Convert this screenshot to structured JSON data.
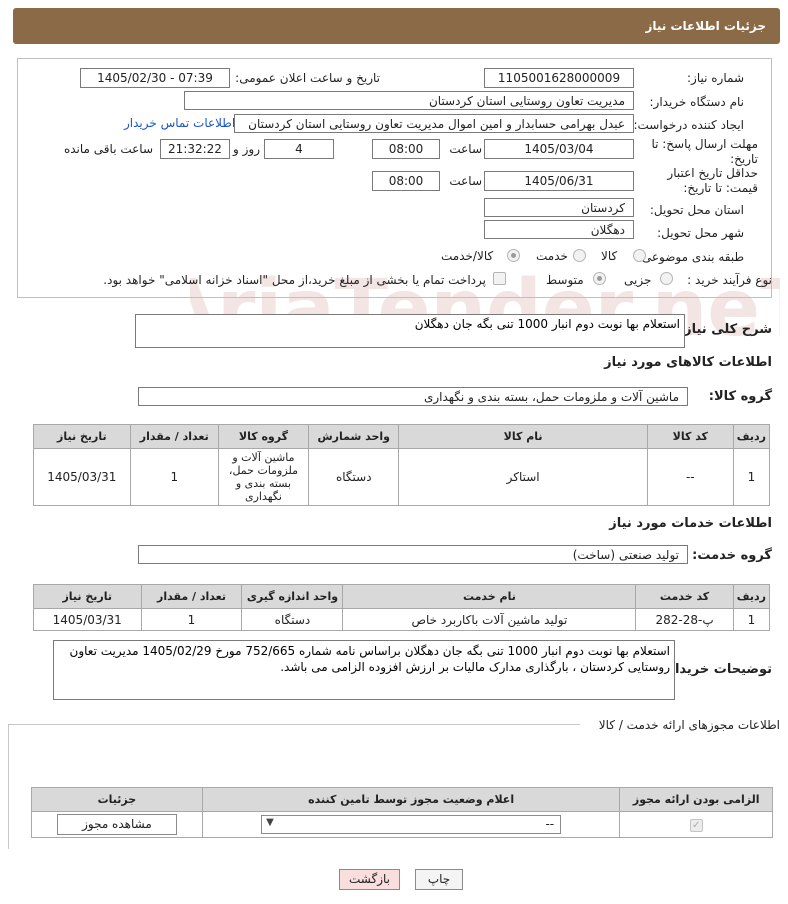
{
  "header": {
    "title": "جزئیات اطلاعات نیاز"
  },
  "form": {
    "need_number_label": "شماره نیاز:",
    "need_number": "1105001628000009",
    "announce_label": "تاریخ و ساعت اعلان عمومی:",
    "announce_value": "1405/02/30 - 07:39",
    "buyer_org_label": "نام دستگاه خریدار:",
    "buyer_org": "مدیریت تعاون روستایی استان کردستان",
    "creator_label": "ایجاد کننده درخواست:",
    "creator": "عبدل بهرامی حسابدار و امین اموال مدیریت تعاون روستایی استان کردستان",
    "contact_link": "اطلاعات تماس خریدار",
    "reply_deadline_label": "مهلت ارسال پاسخ: تا تاریخ:",
    "reply_date": "1405/03/04",
    "time_label": "ساعت",
    "reply_time": "08:00",
    "days_value": "4",
    "days_label": "روز و",
    "remaining_time": "21:32:22",
    "remaining_label": "ساعت باقی مانده",
    "price_validity_label": "حداقل تاریخ اعتبار قیمت: تا تاریخ:",
    "price_date": "1405/06/31",
    "price_time": "08:00",
    "province_label": "استان محل تحویل:",
    "province": "کردستان",
    "city_label": "شهر محل تحویل:",
    "city": "دهگلان",
    "category_label": "طبقه بندی موضوعی:",
    "category_options": [
      "کالا",
      "خدمت",
      "کالا/خدمت"
    ],
    "category_selected": "کالا/خدمت",
    "process_label": "نوع فرآیند خرید :",
    "process_options": [
      "جزیی",
      "متوسط"
    ],
    "process_selected": "متوسط",
    "payment_note": "پرداخت تمام یا بخشی از مبلغ خرید،از محل \"اسناد خزانه اسلامی\" خواهد بود."
  },
  "description": {
    "label": "شرح کلی نیاز:",
    "value": "استعلام بها نوبت دوم انبار 1000 تنی بگه جان دهگلان"
  },
  "goods": {
    "section_title": "اطلاعات کالاهای مورد نیاز",
    "group_label": "گروه کالا:",
    "group_value": "ماشین آلات و ملزومات حمل، بسته بندی و نگهداری",
    "columns": [
      "ردیف",
      "کد کالا",
      "نام کالا",
      "واحد شمارش",
      "گروه کالا",
      "تعداد / مقدار",
      "تاریخ نیاز"
    ],
    "rows": [
      [
        "1",
        "--",
        "استاکر",
        "دستگاه",
        "ماشین آلات و ملزومات حمل، بسته بندی و نگهداری",
        "1",
        "1405/03/31"
      ]
    ]
  },
  "services": {
    "section_title": "اطلاعات خدمات مورد نیاز",
    "group_label": "گروه خدمت:",
    "group_value": "تولید صنعتی (ساخت)",
    "columns": [
      "ردیف",
      "کد خدمت",
      "نام خدمت",
      "واحد اندازه گیری",
      "تعداد / مقدار",
      "تاریخ نیاز"
    ],
    "rows": [
      [
        "1",
        "پ-28-282",
        "تولید ماشین آلات باکاربرد خاص",
        "دستگاه",
        "1",
        "1405/03/31"
      ]
    ]
  },
  "buyer_notes": {
    "label": "توضیحات خریدار:",
    "value": "استعلام بها نوبت دوم انبار 1000 تنی بگه جان دهگلان براساس نامه شماره 752/665 مورخ 1405/02/29 مدیریت تعاون روستایی کردستان ، بارگذاری مدارک مالیات بر ارزش افزوده الزامی می باشد."
  },
  "permits": {
    "section_title": "اطلاعات مجوزهای ارائه خدمت / کالا",
    "columns": [
      "الزامی بودن ارائه مجوز",
      "اعلام وضعیت مجوز توسط تامین کننده",
      "جزئیات"
    ],
    "select_value": "--",
    "view_button": "مشاهده مجوز"
  },
  "actions": {
    "print": "چاپ",
    "back": "بازگشت"
  },
  "watermark": {
    "text": "AriaTender.neT"
  },
  "colors": {
    "header": "#8b6b47",
    "link": "#1a55c7",
    "back_button": "#f9dede"
  }
}
